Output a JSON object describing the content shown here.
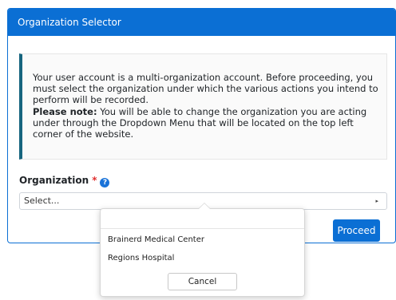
{
  "modal": {
    "title": "Organization Selector",
    "notice_text": "Your user account is a multi-organization account. Before proceeding, you must select the organization under which the various actions you intend to perform will be recorded.",
    "notice_bold": "Please note:",
    "notice_note": " You will be able to change the organization you are acting under through the Dropdown Menu that will be located on the top left corner of the website.",
    "field_label": "Organization",
    "required_mark": "*",
    "help_icon": "question-circle-icon",
    "help_glyph": "?",
    "select_placeholder": "Select...",
    "select_arrow_glyph": "▸",
    "proceed_label": "Proceed"
  },
  "dropdown": {
    "items": [
      "Brainerd Medical Center",
      "Regions Hospital"
    ],
    "cancel_label": "Cancel"
  },
  "colors": {
    "header_bg": "#0b6fd4",
    "notice_accent": "#17657f",
    "required": "#e03030",
    "help_icon": "#1a73d9"
  }
}
